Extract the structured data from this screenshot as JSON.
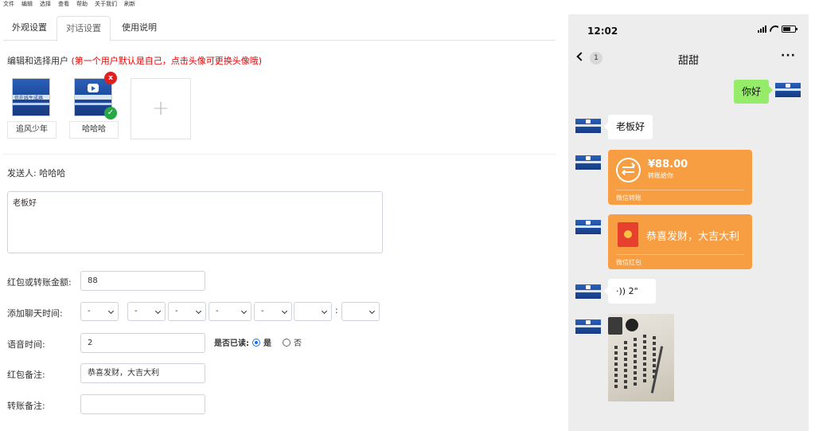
{
  "menu": [
    "文件",
    "编辑",
    "选择",
    "查看",
    "帮助",
    "关于我们",
    "刷新"
  ],
  "tabs": [
    "外观设置",
    "对话设置",
    "使用说明"
  ],
  "active_tab": "对话设置",
  "users_section": {
    "title": "编辑和选择用户",
    "hint": "(第一个用户默认是自己，点击头像可更换头像哦)",
    "users": [
      "追风少年",
      "哈哈哈"
    ],
    "avatar_caption": "信在线生成器",
    "remove_badge": "x",
    "add_symbol": "+"
  },
  "sender": {
    "label": "发送人:",
    "name": "哈哈哈"
  },
  "message_text": "老板好",
  "form": {
    "amount_label": "红包或转账金额:",
    "amount_value": "88",
    "time_label": "添加聊天时间:",
    "time_placeholder": "-",
    "time_separator": ":",
    "voice_label": "语音时间:",
    "voice_value": "2",
    "read_label": "是否已读:",
    "read_yes": "是",
    "read_no": "否",
    "redpacket_label": "红包备注:",
    "redpacket_value": "恭喜发财，大吉大利",
    "transfer_label": "转账备注:",
    "transfer_value": ""
  },
  "phone": {
    "time": "12:02",
    "unread": "1",
    "chat_title": "甜甜",
    "more": "···",
    "msg_out": "你好",
    "msg_in": "老板好",
    "transfer": {
      "amount": "¥88.00",
      "subtitle": "转账给你",
      "footer": "微信转账"
    },
    "redpacket": {
      "text": "恭喜发财，大吉大利",
      "footer": "微信红包"
    },
    "voice": {
      "icon": "·))",
      "duration": "2\""
    }
  }
}
